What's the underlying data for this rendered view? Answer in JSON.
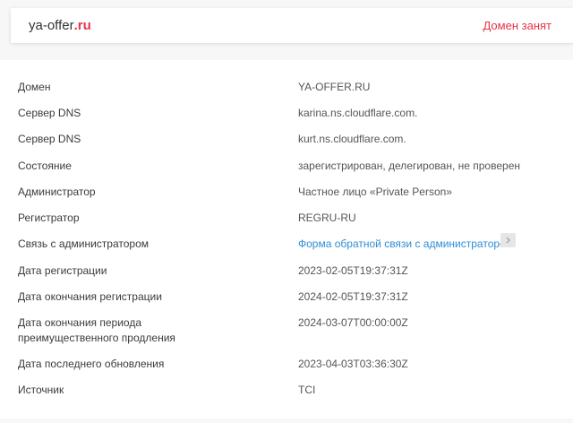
{
  "header": {
    "domain_name": "ya-offer",
    "domain_tld": ".ru",
    "status": "Домен занят"
  },
  "rows": [
    {
      "label": "Домен",
      "value": "YA-OFFER.RU"
    },
    {
      "label": "Сервер DNS",
      "value": "karina.ns.cloudflare.com."
    },
    {
      "label": "Сервер DNS",
      "value": "kurt.ns.cloudflare.com."
    },
    {
      "label": "Состояние",
      "value": "зарегистрирован, делегирован, не проверен"
    },
    {
      "label": "Администратор",
      "value": "Частное лицо «Private Person»"
    },
    {
      "label": "Регистратор",
      "value": "REGRU-RU"
    },
    {
      "label": "Связь с администратором",
      "value": "Форма обратной связи с администратором",
      "arrow_icon": "chevron-right-icon"
    },
    {
      "label": "Дата регистрации",
      "value": "2023-02-05T19:37:31Z"
    },
    {
      "label": "Дата окончания регистрации",
      "value": "2024-02-05T19:37:31Z"
    },
    {
      "label_line1": "Дата окончания периода",
      "label_line2": "преимущественного продления",
      "value": "2024-03-07T00:00:00Z"
    },
    {
      "label": "Дата последнего обновления",
      "value": "2023-04-03T03:36:30Z"
    },
    {
      "label": "Источник",
      "value": "TCI"
    }
  ],
  "colors": {
    "accent": "#e8334a",
    "link": "#2d8fd6",
    "background": "#f7f7f8"
  }
}
